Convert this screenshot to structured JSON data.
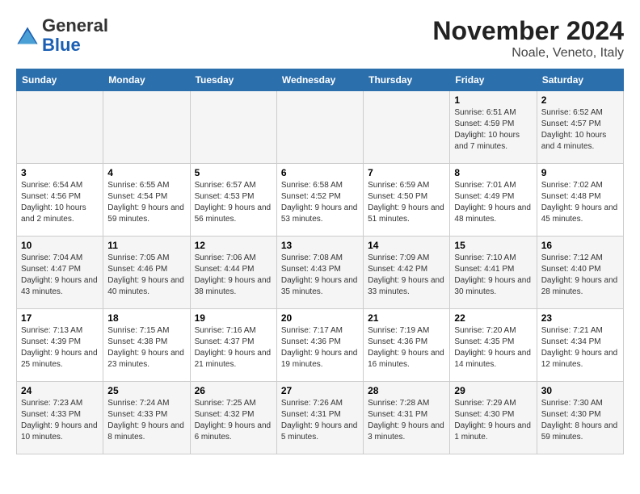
{
  "logo": {
    "general": "General",
    "blue": "Blue"
  },
  "title": "November 2024",
  "subtitle": "Noale, Veneto, Italy",
  "weekdays": [
    "Sunday",
    "Monday",
    "Tuesday",
    "Wednesday",
    "Thursday",
    "Friday",
    "Saturday"
  ],
  "weeks": [
    [
      {
        "day": "",
        "info": ""
      },
      {
        "day": "",
        "info": ""
      },
      {
        "day": "",
        "info": ""
      },
      {
        "day": "",
        "info": ""
      },
      {
        "day": "",
        "info": ""
      },
      {
        "day": "1",
        "info": "Sunrise: 6:51 AM\nSunset: 4:59 PM\nDaylight: 10 hours and 7 minutes."
      },
      {
        "day": "2",
        "info": "Sunrise: 6:52 AM\nSunset: 4:57 PM\nDaylight: 10 hours and 4 minutes."
      }
    ],
    [
      {
        "day": "3",
        "info": "Sunrise: 6:54 AM\nSunset: 4:56 PM\nDaylight: 10 hours and 2 minutes."
      },
      {
        "day": "4",
        "info": "Sunrise: 6:55 AM\nSunset: 4:54 PM\nDaylight: 9 hours and 59 minutes."
      },
      {
        "day": "5",
        "info": "Sunrise: 6:57 AM\nSunset: 4:53 PM\nDaylight: 9 hours and 56 minutes."
      },
      {
        "day": "6",
        "info": "Sunrise: 6:58 AM\nSunset: 4:52 PM\nDaylight: 9 hours and 53 minutes."
      },
      {
        "day": "7",
        "info": "Sunrise: 6:59 AM\nSunset: 4:50 PM\nDaylight: 9 hours and 51 minutes."
      },
      {
        "day": "8",
        "info": "Sunrise: 7:01 AM\nSunset: 4:49 PM\nDaylight: 9 hours and 48 minutes."
      },
      {
        "day": "9",
        "info": "Sunrise: 7:02 AM\nSunset: 4:48 PM\nDaylight: 9 hours and 45 minutes."
      }
    ],
    [
      {
        "day": "10",
        "info": "Sunrise: 7:04 AM\nSunset: 4:47 PM\nDaylight: 9 hours and 43 minutes."
      },
      {
        "day": "11",
        "info": "Sunrise: 7:05 AM\nSunset: 4:46 PM\nDaylight: 9 hours and 40 minutes."
      },
      {
        "day": "12",
        "info": "Sunrise: 7:06 AM\nSunset: 4:44 PM\nDaylight: 9 hours and 38 minutes."
      },
      {
        "day": "13",
        "info": "Sunrise: 7:08 AM\nSunset: 4:43 PM\nDaylight: 9 hours and 35 minutes."
      },
      {
        "day": "14",
        "info": "Sunrise: 7:09 AM\nSunset: 4:42 PM\nDaylight: 9 hours and 33 minutes."
      },
      {
        "day": "15",
        "info": "Sunrise: 7:10 AM\nSunset: 4:41 PM\nDaylight: 9 hours and 30 minutes."
      },
      {
        "day": "16",
        "info": "Sunrise: 7:12 AM\nSunset: 4:40 PM\nDaylight: 9 hours and 28 minutes."
      }
    ],
    [
      {
        "day": "17",
        "info": "Sunrise: 7:13 AM\nSunset: 4:39 PM\nDaylight: 9 hours and 25 minutes."
      },
      {
        "day": "18",
        "info": "Sunrise: 7:15 AM\nSunset: 4:38 PM\nDaylight: 9 hours and 23 minutes."
      },
      {
        "day": "19",
        "info": "Sunrise: 7:16 AM\nSunset: 4:37 PM\nDaylight: 9 hours and 21 minutes."
      },
      {
        "day": "20",
        "info": "Sunrise: 7:17 AM\nSunset: 4:36 PM\nDaylight: 9 hours and 19 minutes."
      },
      {
        "day": "21",
        "info": "Sunrise: 7:19 AM\nSunset: 4:36 PM\nDaylight: 9 hours and 16 minutes."
      },
      {
        "day": "22",
        "info": "Sunrise: 7:20 AM\nSunset: 4:35 PM\nDaylight: 9 hours and 14 minutes."
      },
      {
        "day": "23",
        "info": "Sunrise: 7:21 AM\nSunset: 4:34 PM\nDaylight: 9 hours and 12 minutes."
      }
    ],
    [
      {
        "day": "24",
        "info": "Sunrise: 7:23 AM\nSunset: 4:33 PM\nDaylight: 9 hours and 10 minutes."
      },
      {
        "day": "25",
        "info": "Sunrise: 7:24 AM\nSunset: 4:33 PM\nDaylight: 9 hours and 8 minutes."
      },
      {
        "day": "26",
        "info": "Sunrise: 7:25 AM\nSunset: 4:32 PM\nDaylight: 9 hours and 6 minutes."
      },
      {
        "day": "27",
        "info": "Sunrise: 7:26 AM\nSunset: 4:31 PM\nDaylight: 9 hours and 5 minutes."
      },
      {
        "day": "28",
        "info": "Sunrise: 7:28 AM\nSunset: 4:31 PM\nDaylight: 9 hours and 3 minutes."
      },
      {
        "day": "29",
        "info": "Sunrise: 7:29 AM\nSunset: 4:30 PM\nDaylight: 9 hours and 1 minute."
      },
      {
        "day": "30",
        "info": "Sunrise: 7:30 AM\nSunset: 4:30 PM\nDaylight: 8 hours and 59 minutes."
      }
    ]
  ]
}
